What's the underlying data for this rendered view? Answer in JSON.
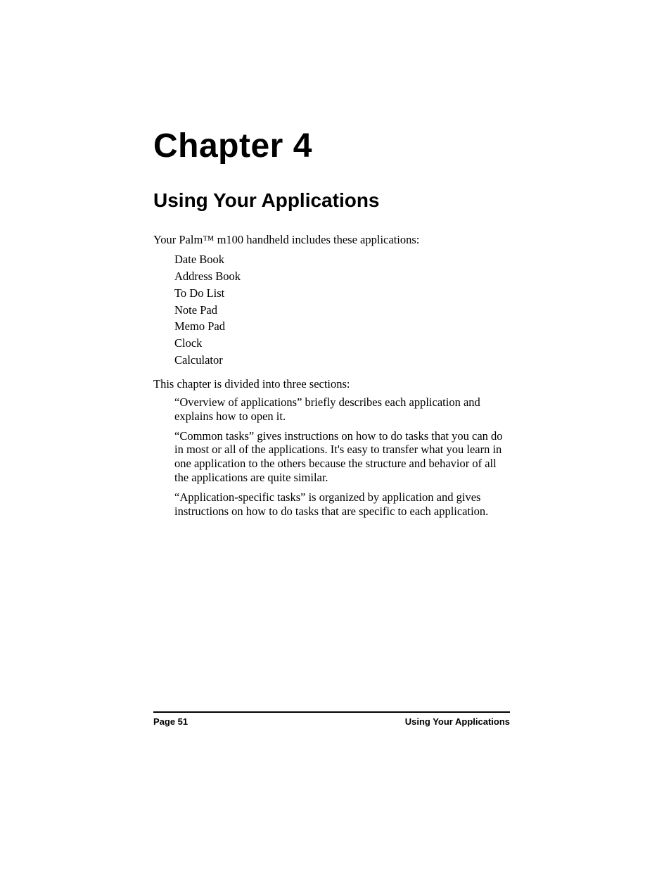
{
  "chapter": {
    "title": "Chapter 4"
  },
  "section": {
    "title": "Using Your Applications"
  },
  "intro": "Your Palm™ m100 handheld includes these applications:",
  "apps": [
    "Date Book",
    "Address Book",
    "To Do List",
    "Note Pad",
    "Memo Pad",
    "Clock",
    "Calculator"
  ],
  "divider_text": "This chapter is divided into three sections:",
  "descriptions": [
    "“Overview of applications” briefly describes each application and explains how to open it.",
    "“Common tasks” gives instructions on how to do tasks that you can do in most or all of the applications. It's easy to transfer what you learn in one application to the others because the structure and behavior of all the applications are quite similar.",
    "“Application-specific tasks” is organized by application and gives instructions on how to do tasks that are specific to each application."
  ],
  "footer": {
    "page_label": "Page 51",
    "section_label": "Using Your Applications"
  }
}
